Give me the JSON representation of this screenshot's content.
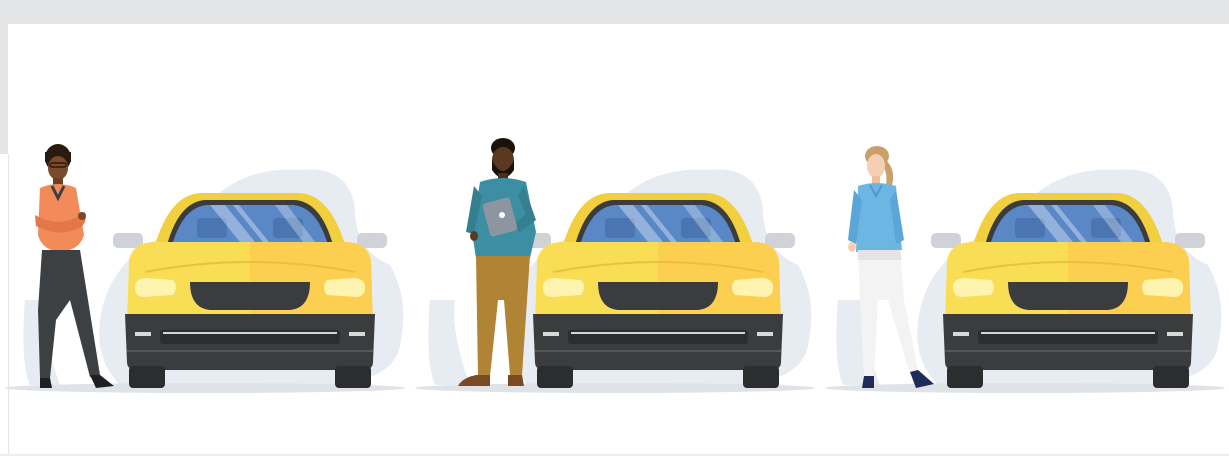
{
  "image": {
    "colors": {
      "frame": "#e4e5e7",
      "blob": "#e7ecf3",
      "ground": "#dfe2e6",
      "car_body": "#f8dd55",
      "car_highlight": "#ffc94e",
      "car_dark": "#3b3c3e",
      "windshield": "#5a88c7",
      "headlight": "#fff3b0"
    },
    "people": [
      {
        "name": "woman-orange-sweater",
        "top": "#f28a5a",
        "pants": "#3c4043",
        "skin": "#7a4a2a",
        "hair": "#2a1a10"
      },
      {
        "name": "man-teal-sweater",
        "top": "#3c8fa3",
        "pants": "#b08434",
        "skin": "#5b3920",
        "hair": "#1a120b"
      },
      {
        "name": "woman-blue-shirt",
        "top": "#6db5e3",
        "pants": "#f3f3f3",
        "skin": "#f5cfb3",
        "hair": "#caa06a"
      }
    ]
  }
}
